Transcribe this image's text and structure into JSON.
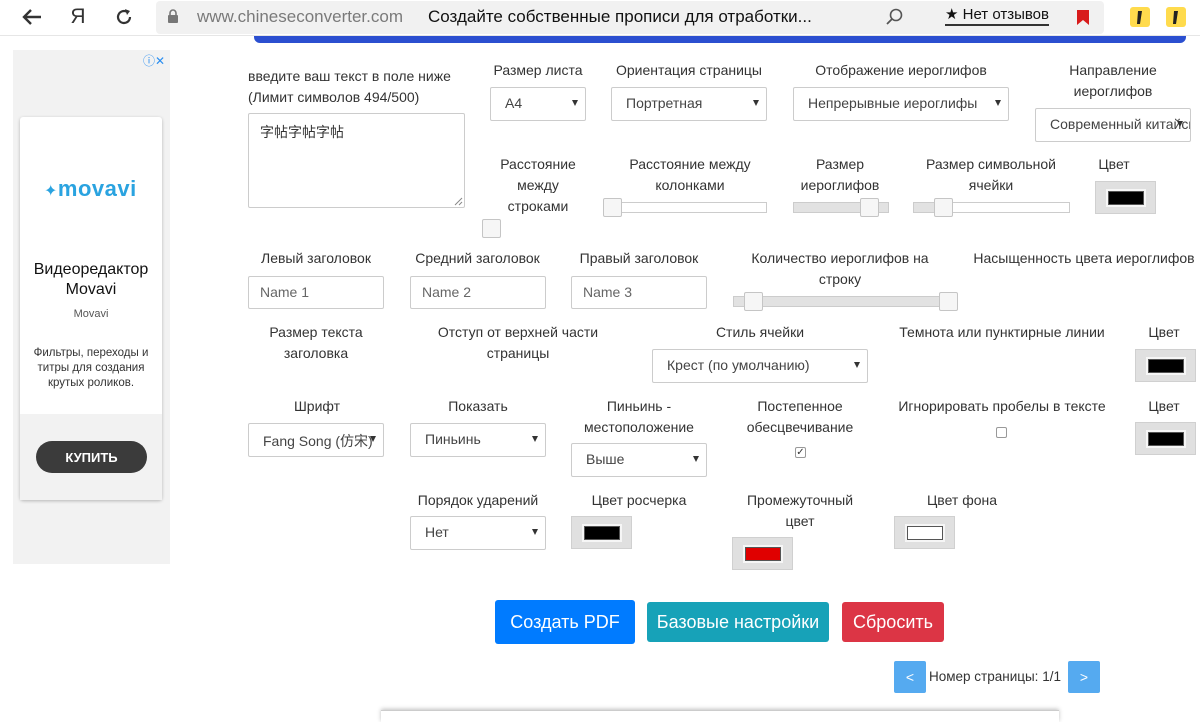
{
  "browser": {
    "domain": "www.chineseconverter.com",
    "page_title": "Создайте собственные прописи для отработки...",
    "reviews": "★ Нет отзывов",
    "yandex_letter": "Я"
  },
  "ad": {
    "logo": "movavi",
    "title": "Видеоредактор Movavi",
    "brand": "Movavi",
    "description": "Фильтры, переходы и титры для создания крутых роликов.",
    "button": "КУПИТЬ"
  },
  "form": {
    "text_label": "введите ваш текст в поле ниже (Лимит символов 494/500)",
    "text_value": "字帖字帖字帖",
    "sheet_size_label": "Размер листа",
    "sheet_size_value": "A4",
    "orientation_label": "Ориентация страницы",
    "orientation_value": "Портретная",
    "glyph_display_label": "Отображение иероглифов",
    "glyph_display_value": "Непрерывные иероглифы",
    "glyph_direction_label": "Направление иероглифов",
    "glyph_direction_value": "Современный китайский",
    "row_spacing_label": "Расстояние между строками",
    "column_spacing_label": "Расстояние между колонками",
    "glyph_size_label": "Размер иероглифов",
    "cell_size_label": "Размер символьной ячейки",
    "color_label": "Цвет",
    "left_header_label": "Левый заголовок",
    "left_header_placeholder": "Name 1",
    "middle_header_label": "Средний заголовок",
    "middle_header_placeholder": "Name 2",
    "right_header_label": "Правый заголовок",
    "right_header_placeholder": "Name 3",
    "glyphs_per_row_label": "Количество иероглифов на строку",
    "saturation_label": "Насыщенность цвета иероглифов",
    "header_text_size_label": "Размер текста заголовка",
    "top_offset_label": "Отступ от верхней части страницы",
    "cell_style_label": "Стиль ячейки",
    "cell_style_value": "Крест (по умолчанию)",
    "dark_lines_label": "Темнота или пунктирные линии",
    "font_label": "Шрифт",
    "font_value": "Fang Song (仿宋)",
    "show_label": "Показать",
    "show_value": "Пиньинь",
    "pinyin_position_label": "Пиньинь - местоположение",
    "pinyin_position_value": "Выше",
    "fade_label": "Постепенное обесцвечивание",
    "fade_checked": "✓",
    "ignore_spaces_label": "Игнорировать пробелы в тексте",
    "stroke_order_label": "Порядок ударений",
    "stroke_order_value": "Нет",
    "stroke_color_label": "Цвет росчерка",
    "intermediate_color_label": "Промежуточный цвет",
    "background_color_label": "Цвет фона"
  },
  "colors": {
    "glyph_color": "#000000",
    "line_color": "#000000",
    "ignore_color": "#000000",
    "stroke_color": "#000000",
    "intermediate_color": "#e00000",
    "background_color": "#ffffff"
  },
  "buttons": {
    "create_pdf": "Создать PDF",
    "base_settings": "Базовые настройки",
    "reset": "Сбросить"
  },
  "pagination": {
    "prev": "<",
    "next": ">",
    "page_label": "Номер страницы: 1/1"
  }
}
